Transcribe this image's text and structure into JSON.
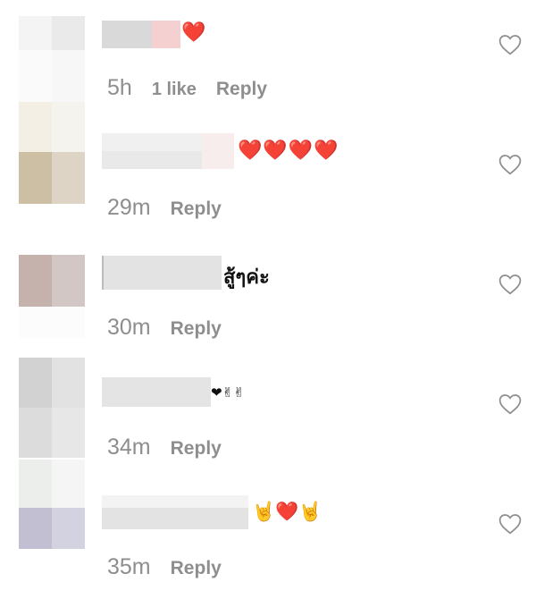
{
  "comments": [
    {
      "text": "❤️",
      "time": "5h",
      "likes": "1 like",
      "reply": "Reply"
    },
    {
      "text": "❤️❤️❤️❤️",
      "time": "29m",
      "likes": "",
      "reply": "Reply"
    },
    {
      "text": "สู้ๆค่ะ",
      "time": "30m",
      "likes": "",
      "reply": "Reply"
    },
    {
      "text": "❤✌✌",
      "time": "34m",
      "likes": "",
      "reply": "Reply"
    },
    {
      "text": "🤘❤️🤘",
      "time": "35m",
      "likes": "",
      "reply": "Reply"
    }
  ],
  "icons": {
    "like": "heart-outline-icon"
  },
  "colors": {
    "meta_text": "#8e8e8e",
    "heart_red": "#e0245e"
  }
}
